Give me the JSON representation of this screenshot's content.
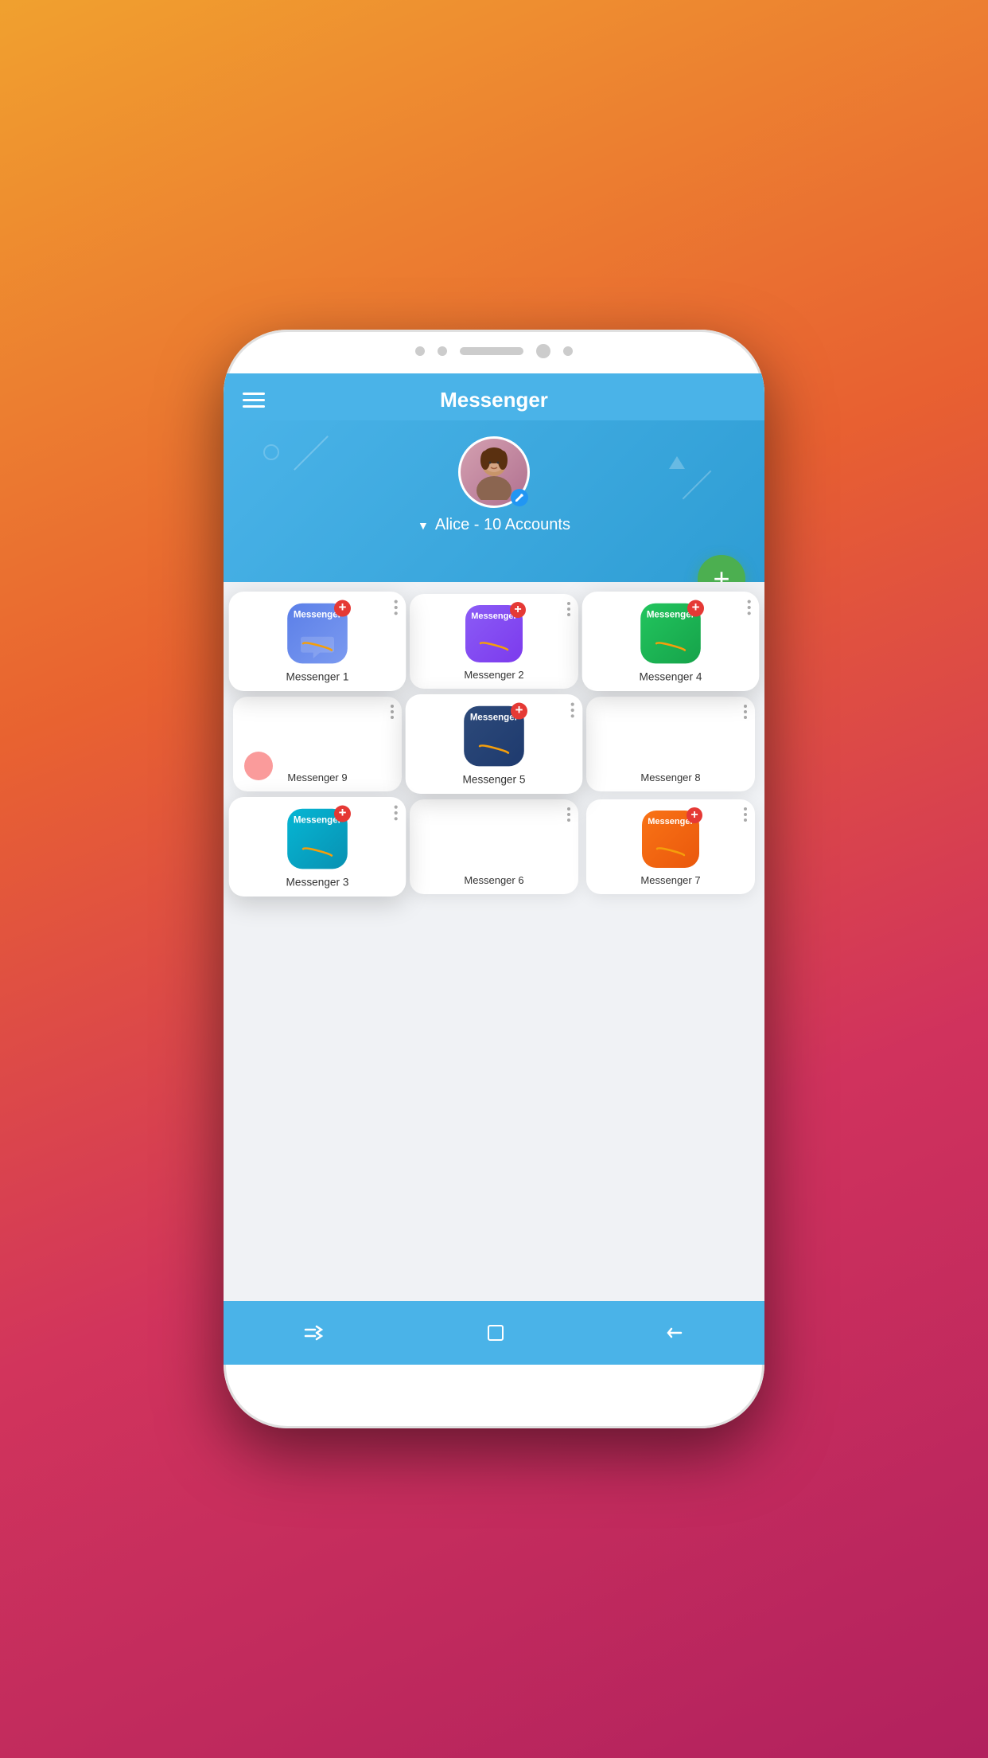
{
  "app": {
    "title": "Messenger"
  },
  "header": {
    "hamburger_label": "menu",
    "title": "Messenger"
  },
  "profile": {
    "name": "Alice",
    "accounts_count": "10 Accounts",
    "display": "Alice - 10 Accounts",
    "edit_icon": "✓"
  },
  "fab": {
    "label": "+"
  },
  "apps": [
    {
      "id": 1,
      "name": "Messenger 1",
      "color_class": "icon-blue",
      "highlighted": true
    },
    {
      "id": 2,
      "name": "Messenger 2",
      "color_class": "icon-purple",
      "highlighted": false
    },
    {
      "id": 4,
      "name": "Messenger 4",
      "color_class": "icon-green",
      "highlighted": true
    },
    {
      "id": 9,
      "name": "Messenger 9",
      "color_class": "icon-coral",
      "highlighted": false
    },
    {
      "id": 5,
      "name": "Messenger 5",
      "color_class": "icon-navy",
      "highlighted": true
    },
    {
      "id": 8,
      "name": "Messenger 8",
      "color_class": "icon-teal",
      "highlighted": false
    },
    {
      "id": 3,
      "name": "Messenger 3",
      "color_class": "icon-teal",
      "highlighted": true
    },
    {
      "id": 6,
      "name": "Messenger 6",
      "color_class": "icon-pink",
      "highlighted": false
    },
    {
      "id": 7,
      "name": "Messenger 7",
      "color_class": "icon-orange",
      "highlighted": false
    }
  ],
  "nav": {
    "left_icon": "⇌",
    "center_icon": "◻",
    "right_icon": "←"
  }
}
